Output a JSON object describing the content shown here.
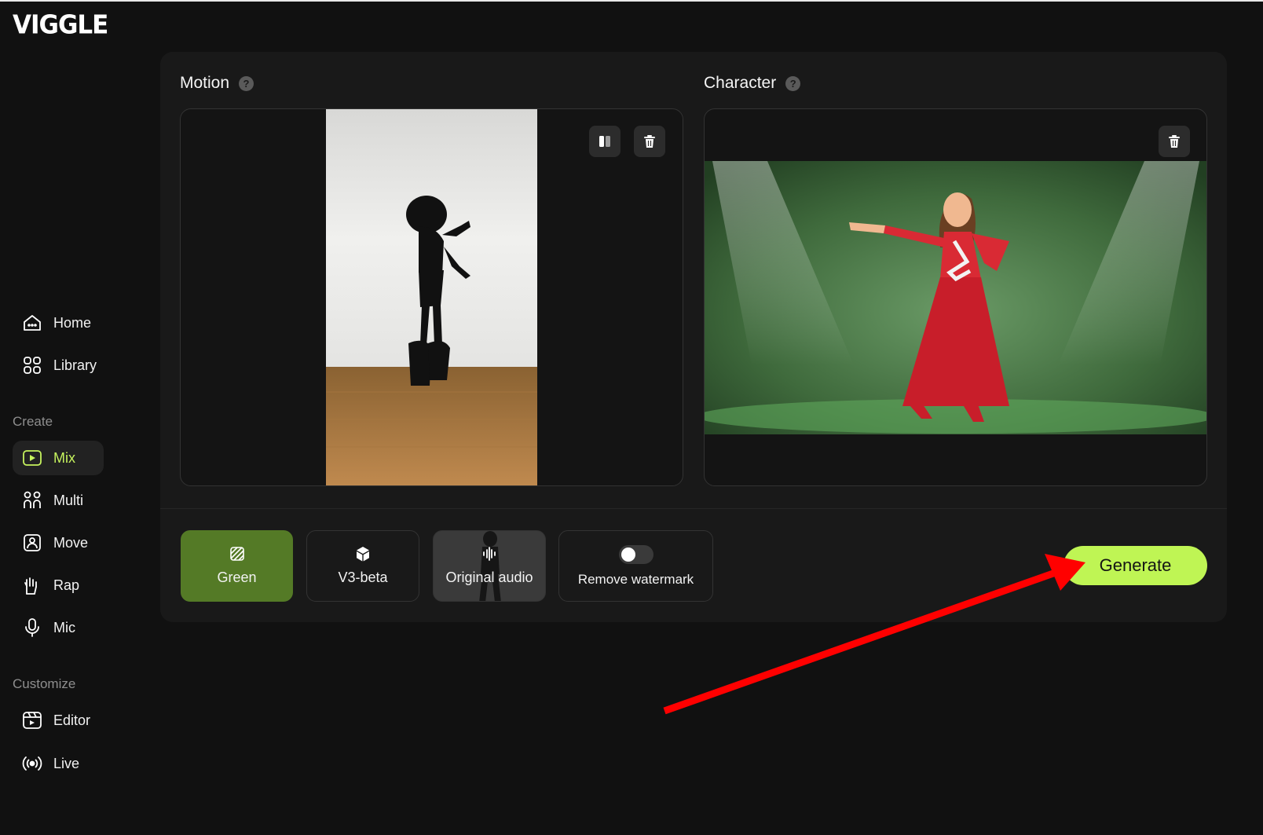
{
  "app": {
    "logo": "VIGGLE"
  },
  "sidebar": {
    "items": [
      {
        "label": "Home",
        "icon": "home-icon"
      },
      {
        "label": "Library",
        "icon": "library-icon"
      }
    ],
    "create_label": "Create",
    "create_items": [
      {
        "label": "Mix",
        "icon": "mix-icon",
        "active": true
      },
      {
        "label": "Multi",
        "icon": "multi-icon"
      },
      {
        "label": "Move",
        "icon": "move-icon"
      },
      {
        "label": "Rap",
        "icon": "rap-icon"
      },
      {
        "label": "Mic",
        "icon": "mic-icon"
      }
    ],
    "customize_label": "Customize",
    "customize_items": [
      {
        "label": "Editor",
        "icon": "editor-icon"
      },
      {
        "label": "Live",
        "icon": "live-icon"
      }
    ]
  },
  "main": {
    "motion": {
      "title": "Motion",
      "help": "?"
    },
    "character": {
      "title": "Character",
      "help": "?"
    },
    "options": {
      "green": "Green",
      "v3": "V3-beta",
      "audio": "Original audio",
      "watermark": "Remove watermark",
      "watermark_on": false
    },
    "generate": "Generate"
  },
  "colors": {
    "accent": "#bff554",
    "active_text": "#c6f35e",
    "green_option": "#547a26",
    "annotation_arrow": "#ff0000"
  }
}
